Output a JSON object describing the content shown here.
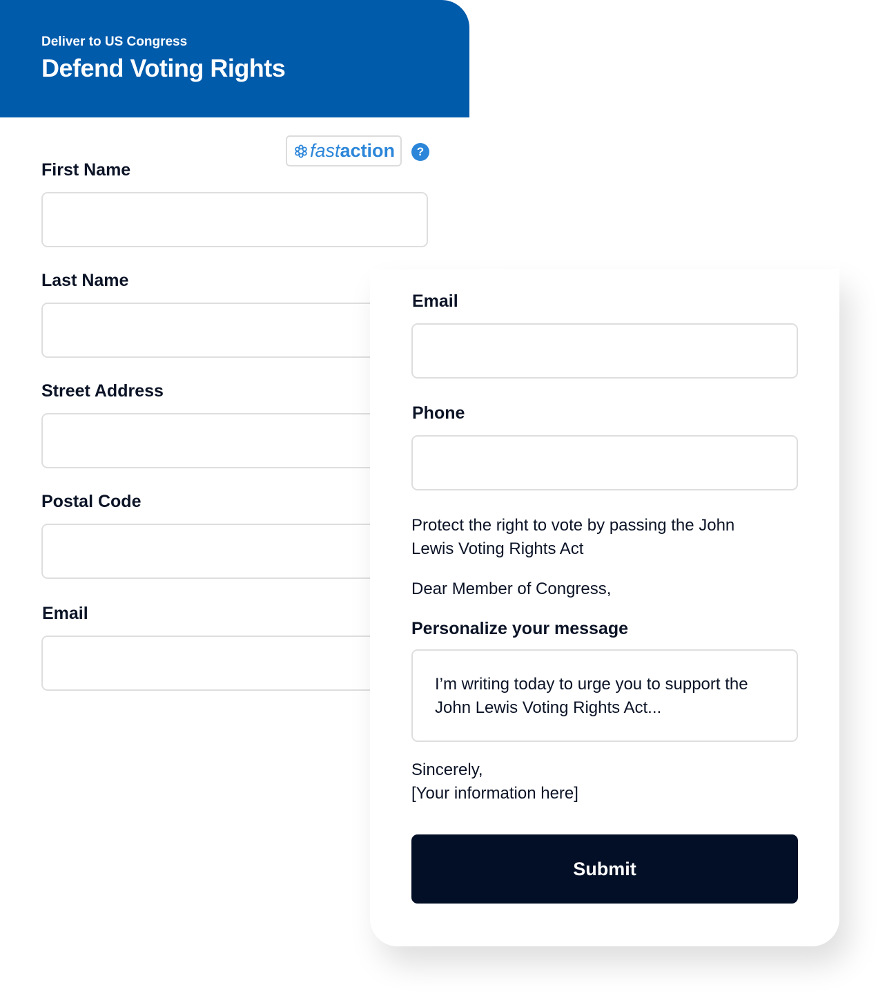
{
  "header": {
    "subtitle": "Deliver to US Congress",
    "title": "Defend Voting Rights",
    "background_color": "#005bab"
  },
  "fastaction": {
    "brand_prefix": "fast",
    "brand_suffix": "action",
    "help_symbol": "?",
    "icons": [
      "flower-logo-icon",
      "help-icon"
    ],
    "accent_color": "#2b86d9"
  },
  "back_form": {
    "first_name_label": "First Name",
    "last_name_label": "Last Name",
    "street_address_label": "Street Address",
    "postal_code_label": "Postal Code",
    "email_label": "Email"
  },
  "front_form": {
    "email_label": "Email",
    "phone_label": "Phone",
    "subject": "Protect the right to vote by passing the John Lewis Voting Rights Act",
    "salutation": "Dear Member of Congress,",
    "personalize_label": "Personalize your message",
    "message": "I’m writing today to urge you to support the John Lewis Voting Rights Act...",
    "closing": "Sincerely,",
    "signature": "[Your information here]",
    "submit_label": "Submit",
    "submit_color": "#020f26"
  }
}
